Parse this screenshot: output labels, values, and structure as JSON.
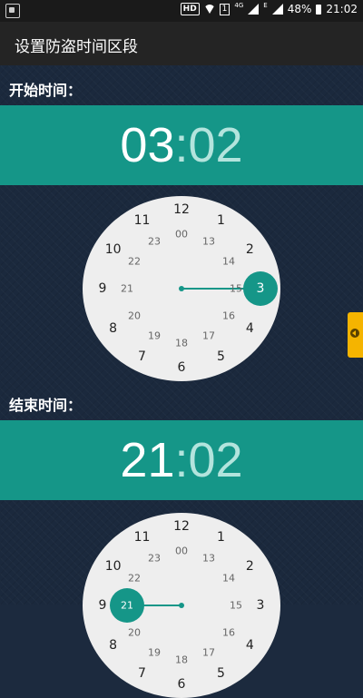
{
  "status_bar": {
    "hd": "HD",
    "sim": "1",
    "net": "4G",
    "e": "E",
    "battery": "48%",
    "time": "21:02"
  },
  "app_bar": {
    "title": "设置防盗时间区段"
  },
  "start": {
    "label": "开始时间：",
    "hour": "03",
    "separator": ":",
    "minute": "02",
    "selected_hour": "3"
  },
  "end": {
    "label": "结束时间：",
    "hour": "21",
    "separator": ":",
    "minute": "02",
    "selected_hour": "21"
  },
  "dial": {
    "outer": [
      "12",
      "1",
      "2",
      "3",
      "4",
      "5",
      "6",
      "7",
      "8",
      "9",
      "10",
      "11"
    ],
    "inner": [
      "00",
      "13",
      "14",
      "15",
      "16",
      "17",
      "18",
      "19",
      "20",
      "21",
      "22",
      "23"
    ]
  },
  "colors": {
    "accent": "#159688",
    "side_tab": "#f5b400"
  },
  "icons": {
    "side_tab": "chevron-left-icon"
  }
}
